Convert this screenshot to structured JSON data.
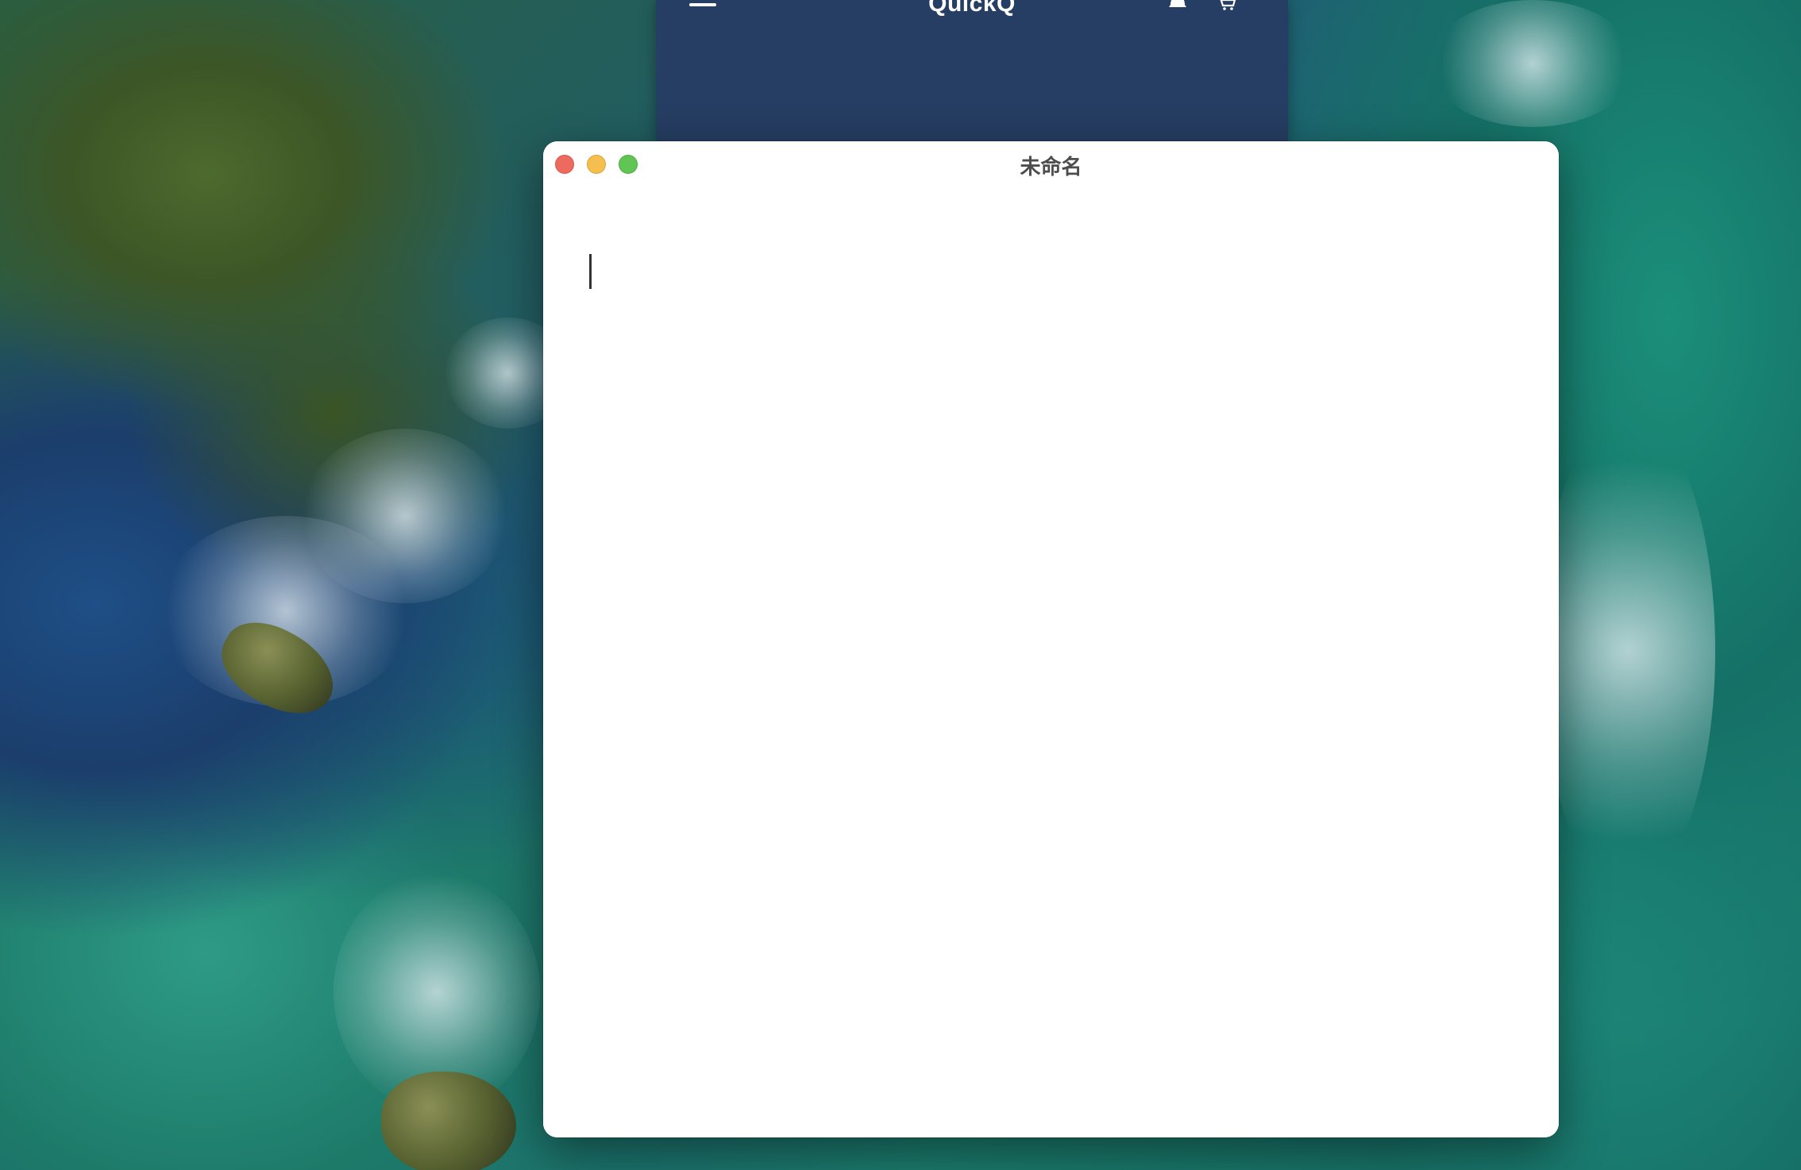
{
  "desktop": {
    "wallpaper": "aerial-coast-wallpaper"
  },
  "background_app": {
    "title": "QuickQ",
    "bar_color": "#263e63",
    "icons": [
      "menu-icon",
      "bell-icon",
      "cart-icon"
    ]
  },
  "editor": {
    "title": "未命名",
    "body_text": "",
    "window_controls": [
      "close",
      "minimize",
      "zoom"
    ],
    "colors": {
      "close": "#ed6a5e",
      "minimize": "#f5bf4f",
      "zoom": "#61c554"
    }
  }
}
